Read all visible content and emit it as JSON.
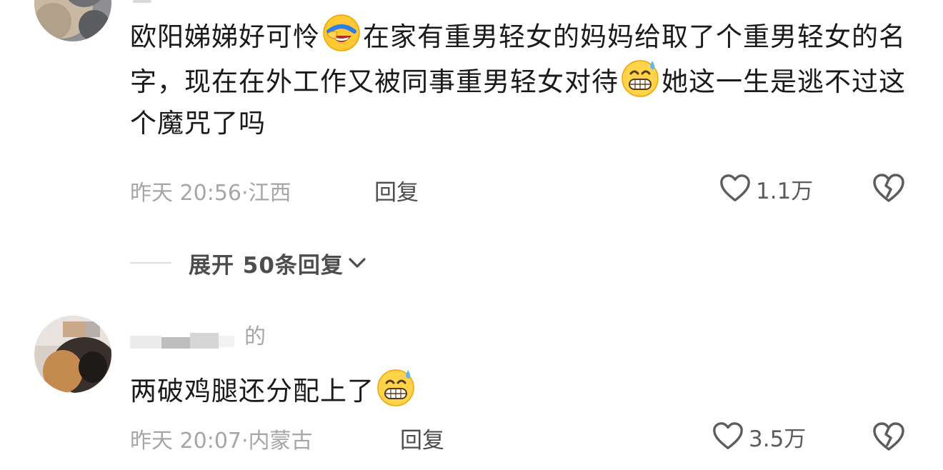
{
  "comments": [
    {
      "text_part1": "欧阳娣娣好可怜",
      "text_part2": "在家有重男轻女的妈妈给取了个重男轻女的名字，现在在外工作又被同事重男轻女对待",
      "text_part3": "她这一生是逃不过这个魔咒了吗",
      "emoji1": "face-palm-laugh-emoji",
      "emoji2": "grinning-sweat-emoji",
      "time": "昨天 20:56",
      "location": "江西",
      "reply_label": "回复",
      "likes": "1.1万",
      "expand_replies": "展开 50条回复"
    },
    {
      "username_visible": "的",
      "text": "两破鸡腿还分配上了",
      "emoji": "grinning-sweat-emoji",
      "time": "昨天 20:07",
      "location": "内蒙古",
      "reply_label": "回复",
      "likes": "3.5万"
    }
  ],
  "separator": "·",
  "colors": {
    "text_primary": "#1a1a1a",
    "text_meta": "#a6a6a6",
    "text_action": "#4d4d4d",
    "background": "#ffffff"
  }
}
